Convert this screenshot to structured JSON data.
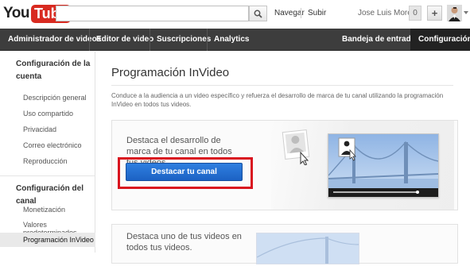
{
  "topbar": {
    "logo_you": "You",
    "logo_tube": "Tube",
    "search_placeholder": "",
    "nav_link": "Navegar",
    "upload_link": "Subir",
    "username": "Jose Luis Moreno",
    "notification_count": "0",
    "plus_label": "+"
  },
  "navbar": {
    "items": [
      {
        "label": "Administrador de videos"
      },
      {
        "label": "Editor de video"
      },
      {
        "label": "Suscripciones"
      },
      {
        "label": "Analytics"
      }
    ],
    "inbox": "Bandeja de entrada",
    "settings": "Configuración"
  },
  "sidebar": {
    "heading1": "Configuración de la cuenta",
    "account_items": [
      {
        "label": "Descripción general"
      },
      {
        "label": "Uso compartido"
      },
      {
        "label": "Privacidad"
      },
      {
        "label": "Correo electrónico"
      },
      {
        "label": "Reproducción"
      }
    ],
    "heading2": "Configuración del canal",
    "channel_items": [
      {
        "label": "Monetización"
      },
      {
        "label": "Valores predeterminados"
      },
      {
        "label": "Programación InVideo"
      }
    ]
  },
  "main": {
    "title": "Programación InVideo",
    "intro": "Conduce a la audiencia a un video específico y refuerza el desarrollo de marca de tu canal utilizando la programación InVideo en todos tus videos.",
    "card1_text": "Destaca el desarrollo de marca de tu canal en todos tus videos.",
    "card1_button": "Destacar tu canal",
    "card2_text": "Destaca uno de tus videos en todos tus videos."
  },
  "colors": {
    "brand_red": "#d82a20",
    "nav_bg": "#3d3d3d",
    "button_blue": "#1c62c4",
    "highlight_red": "#d9141f"
  }
}
